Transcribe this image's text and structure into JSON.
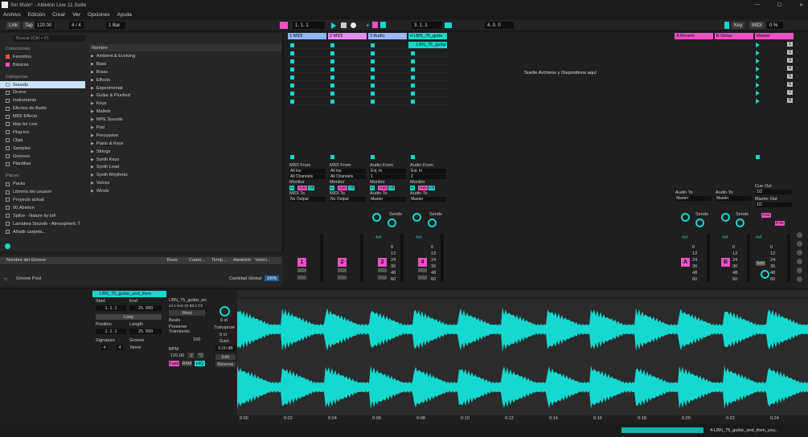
{
  "window": {
    "title": "Sin título* - Ableton Live 11 Suite",
    "minimize": "—",
    "maximize": "☐",
    "close": "✕"
  },
  "menu": [
    "Archivo",
    "Edición",
    "Crear",
    "Ver",
    "Opciones",
    "Ayuda"
  ],
  "transport": {
    "link": "Link",
    "tap": "Tap",
    "tempo": "120.00",
    "meter": "4 / 4",
    "quant": "1 Bar",
    "pos": "1.   1.   1",
    "loop_start": "3.   1.   1",
    "loop_len": "4.   0.   0",
    "key": "Key",
    "midi": "MIDI",
    "cpu": "0 %",
    "arr_pos": "1.   1.   1"
  },
  "browser": {
    "search": "Buscar (Ctrl + F)",
    "col_header": "Nombre",
    "collections_title": "Colecciones",
    "collections": [
      "Favoritos",
      "Básicos"
    ],
    "categories_title": "Categorías",
    "categories": [
      "Sounds",
      "Drums",
      "Instruments",
      "Efectos de Audio",
      "MIDI Effects",
      "Max for Live",
      "Plug-ins",
      "Clips",
      "Samples",
      "Grooves",
      "Plantillas"
    ],
    "places_title": "Places",
    "places": [
      "Packs",
      "Librería del usuario",
      "Proyecto actual",
      "00.Ableton",
      "Splice - Nature by lofi",
      "Laniakea Sounds - Atmospheric T",
      "Añadir carpeta..."
    ],
    "items": [
      "Ambient & Evolving",
      "Bass",
      "Brass",
      "Effects",
      "Experimental",
      "Guitar & Plucked",
      "Keys",
      "Mallets",
      "MPE Sounds",
      "Pad",
      "Percussive",
      "Piano & Keys",
      "Strings",
      "Synth Keys",
      "Synth Lead",
      "Synth Rhythmic",
      "Voices",
      "Winds"
    ]
  },
  "groove": {
    "col_name": "Nombre del Groove",
    "col_base": "Base",
    "col_quant": "Cuant...",
    "col_timing": "Temp...",
    "col_random": "Aleatorio",
    "col_vel": "Veloci...",
    "pool": "Groove Pool",
    "global_label": "Cantidad Global",
    "global_val": "100%"
  },
  "tracks": [
    {
      "name": "1 MIDI",
      "color": "#8fb6ff",
      "num": "1",
      "from_label": "MIDI From",
      "from": "All Ins",
      "ch": "All Channels",
      "mon": "Monitor",
      "mon_in": "In",
      "mon_auto": "Auto",
      "mon_off": "Off",
      "to_label": "MIDI To",
      "to": "No Output"
    },
    {
      "name": "2 MIDI",
      "color": "#e38ef0",
      "num": "2",
      "from_label": "MIDI From",
      "from": "All Ins",
      "ch": "All Channels",
      "mon": "Monitor",
      "mon_in": "In",
      "mon_auto": "Auto",
      "mon_off": "Off",
      "to_label": "MIDI To",
      "to": "No Output"
    },
    {
      "name": "3 Audio",
      "color": "#9bb8ff",
      "num": "3",
      "from_label": "Audio From",
      "from": "Ext. In",
      "ch": "1",
      "mon": "Monitor",
      "mon_in": "In",
      "mon_auto": "Auto",
      "mon_off": "Off",
      "to_label": "Audio To",
      "to": "Master"
    },
    {
      "name": "4 LBN_75_guita",
      "color": "#1fd9c8",
      "num": "4",
      "from_label": "Audio From",
      "from": "Ext. In",
      "ch": "2",
      "mon": "Monitor",
      "mon_in": "In",
      "mon_auto": "Auto",
      "mon_off": "Off",
      "to_label": "Audio To",
      "to": "Master"
    }
  ],
  "clip_name": "LBN_75_guitar",
  "drop_hint": "Suelte Archivos y Dispositivos aquí",
  "returns": [
    {
      "name": "A Reverb",
      "letter": "A",
      "to_label": "Audio To",
      "to": "Master"
    },
    {
      "name": "B Delay",
      "letter": "B",
      "to_label": "Audio To",
      "to": "Master"
    }
  ],
  "master": {
    "name": "Master",
    "cue_label": "Cue Out",
    "cue": "1/2",
    "out_label": "Master Out",
    "out": "1/2",
    "solo": "Solo"
  },
  "mixer": {
    "sends": "Sends",
    "inf": "-Inf",
    "scale": [
      "0",
      "12",
      "24",
      "36",
      "48",
      "60"
    ],
    "scene_nums": [
      "1",
      "2",
      "3",
      "4",
      "5",
      "6",
      "7",
      "8"
    ],
    "post": "Post"
  },
  "clip": {
    "name": "LBN_75_guitar_and_then",
    "start": "Start",
    "end": "End",
    "start_val": "1.   1.   1",
    "end_val": "25.  800",
    "loop": "Loop",
    "position": "Position",
    "length": "Length",
    "pos_val": "1.   1.   1",
    "len_val": "25.  800",
    "signature": "Signature",
    "sig_a": "4",
    "sig_b": "4",
    "groove": "Groove",
    "groove_val": "None",
    "file": "LBN_75_guitar_an",
    "rate": "44.1 kHz  24 Bit  2 Ch",
    "warp": "Warp",
    "mode": "Beats",
    "preserve": "Preserve",
    "trans": "Transients",
    "ratio": "100",
    "bpm": "BPM",
    "bpm_val": "120.00",
    "half": ":2",
    "dbl": "*2",
    "fade": "Fade",
    "ram": "RAM",
    "hiq": "HiQ",
    "transpose": "Transpose",
    "transpose_val": "0 st",
    "detune": "0 ct",
    "gain": "Gain",
    "gain_val": "0.00 dB",
    "edit": "Edit",
    "reverse": "Reverse"
  },
  "timeline": [
    "0:00",
    "0:02",
    "0:04",
    "0:06",
    "0:08",
    "0:10",
    "0:12",
    "0:14",
    "0:16",
    "0:18",
    "0:20",
    "0:22",
    "0:24"
  ],
  "status": {
    "clip": "4-LBN_75_guitar_and_then_you..."
  },
  "colors": {
    "accent": "#13d9d1",
    "pink": "#f04fc6",
    "record": "#ff4a4a"
  }
}
